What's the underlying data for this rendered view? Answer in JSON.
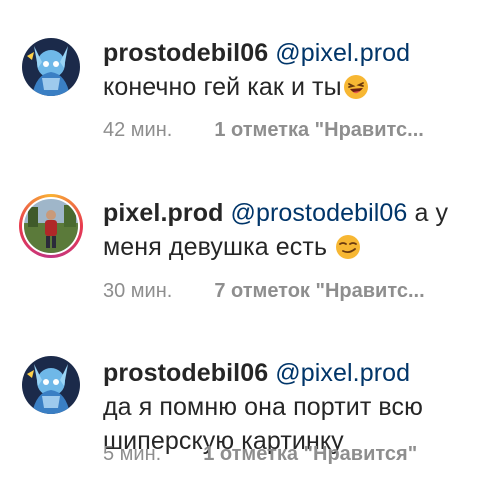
{
  "comments": [
    {
      "username": "prostodebil06",
      "mention": "@pixel.prod",
      "text": "конечно гей как и ты",
      "emoji": "laughing-face-emoji",
      "time": "42 мин.",
      "likes": "1 отметка \"Нравитс..."
    },
    {
      "username": "pixel.prod",
      "mention": "@prostodebil06",
      "text_line1": "а у",
      "text_line2": "меня девушка есть",
      "emoji": "smirking-face-emoji",
      "time": "30 мин.",
      "likes": "7 отметок \"Нравитс..."
    },
    {
      "username": "prostodebil06",
      "mention": "@pixel.prod",
      "text_line1": "да я помню она портит всю",
      "text_line2": "шиперскую картинку",
      "time": "5 мин.",
      "likes": "1 отметка \"Нравится\""
    }
  ],
  "colors": {
    "username": "#262626",
    "mention": "#003569",
    "meta": "#8e8e8e",
    "story_ring": "#e8394e"
  }
}
